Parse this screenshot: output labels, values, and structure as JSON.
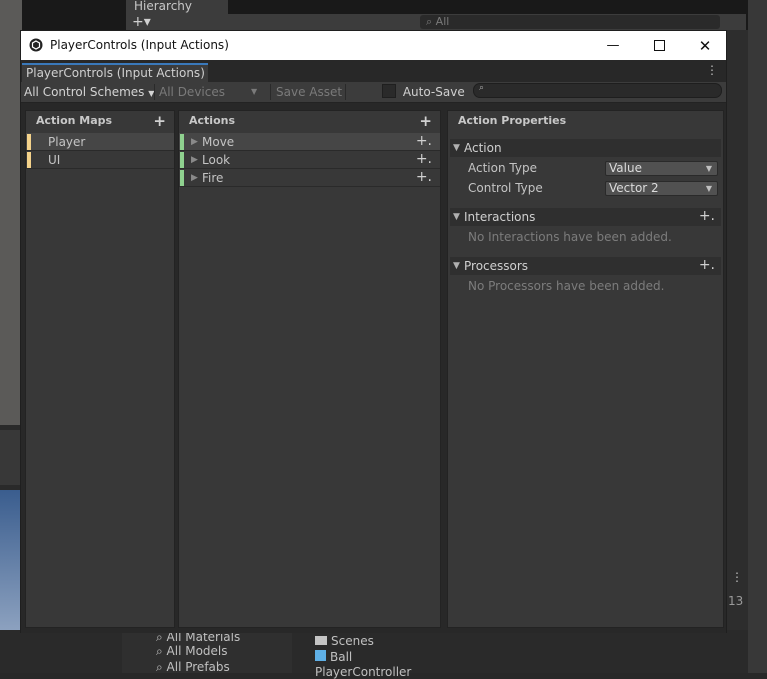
{
  "background": {
    "hierarchy_tab": "Hierarchy",
    "hierarchy_search_placeholder": "All",
    "project_search_items": [
      "All Materials",
      "All Models",
      "All Prefabs"
    ],
    "project_assets": [
      "Scenes",
      "Ball",
      "PlayerController"
    ],
    "right_number": "13"
  },
  "window": {
    "title": "PlayerControls (Input Actions)",
    "tab_label": "PlayerControls (Input Actions)",
    "toolbar": {
      "control_schemes": "All Control Schemes",
      "devices": "All Devices",
      "save_asset": "Save Asset",
      "auto_save": "Auto-Save",
      "auto_save_checked": false
    }
  },
  "action_maps": {
    "header": "Action Maps",
    "items": [
      {
        "label": "Player",
        "selected": true
      },
      {
        "label": "UI",
        "selected": false
      }
    ]
  },
  "actions": {
    "header": "Actions",
    "items": [
      {
        "label": "Move",
        "selected": true
      },
      {
        "label": "Look",
        "selected": false
      },
      {
        "label": "Fire",
        "selected": false
      }
    ]
  },
  "action_properties": {
    "header": "Action Properties",
    "action_section": {
      "label": "Action",
      "action_type_label": "Action Type",
      "action_type_value": "Value",
      "control_type_label": "Control Type",
      "control_type_value": "Vector 2"
    },
    "interactions": {
      "label": "Interactions",
      "empty": "No Interactions have been added."
    },
    "processors": {
      "label": "Processors",
      "empty": "No Processors have been added."
    }
  },
  "colors": {
    "accent_tab": "#3a79bb",
    "action_map_marker": "#f4d28a",
    "action_marker": "#8fd18f"
  }
}
